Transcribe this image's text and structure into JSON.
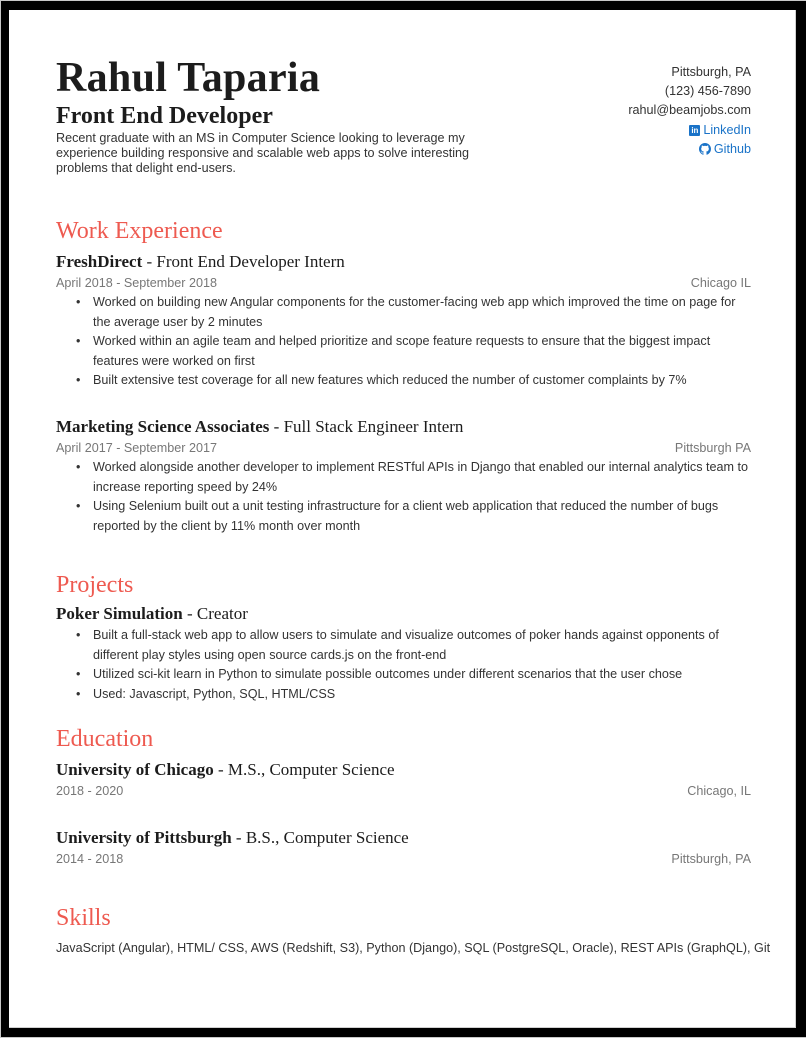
{
  "header": {
    "name": "Rahul Taparia",
    "title": "Front End Developer",
    "summary": "Recent graduate with an MS in Computer Science looking to leverage my experience building responsive and scalable web apps to solve interesting problems that delight end-users."
  },
  "contact": {
    "location": "Pittsburgh, PA",
    "phone": "(123) 456-7890",
    "email": "rahul@beamjobs.com",
    "linkedin_label": "LinkedIn",
    "linkedin_icon": "linkedin-icon",
    "github_label": "Github",
    "github_icon": "github-icon",
    "link_color": "#1a73c8"
  },
  "accent_color": "#ee5a50",
  "sections": {
    "work_title": "Work Experience",
    "projects_title": "Projects",
    "education_title": "Education",
    "skills_title": "Skills"
  },
  "work": [
    {
      "company": "FreshDirect",
      "role": " - Front End Developer Intern",
      "dates": "April 2018 - September 2018",
      "location": "Chicago IL",
      "bullets": [
        "Worked on building new Angular components for the customer-facing web app which improved the time on page for the average user by 2 minutes",
        "Worked within an agile team and helped prioritize and scope feature requests to ensure that the biggest impact features were worked on first",
        "Built extensive test coverage for all new features which reduced the number of customer complaints by 7%"
      ]
    },
    {
      "company": "Marketing Science Associates",
      "role": " - Full Stack Engineer Intern",
      "dates": "April 2017 - September 2017",
      "location": "Pittsburgh PA",
      "bullets": [
        "Worked alongside another developer to implement RESTful APIs in Django that enabled our internal analytics team to increase reporting speed by 24%",
        "Using Selenium built out a unit testing infrastructure for a client web application that reduced the number of bugs reported by the client by 11% month over month"
      ]
    }
  ],
  "projects": [
    {
      "name": "Poker Simulation",
      "role": " - Creator",
      "bullets": [
        "Built a full-stack web app to allow users to simulate and visualize outcomes of poker hands against opponents of different play styles using open source cards.js on the front-end",
        "Utilized sci-kit learn in Python to simulate possible outcomes under different scenarios that the user chose",
        "Used: Javascript, Python, SQL, HTML/CSS"
      ]
    }
  ],
  "education": [
    {
      "school": "University of Chicago",
      "degree": " - M.S., Computer Science",
      "dates": "2018 - 2020",
      "location": "Chicago, IL"
    },
    {
      "school": "University of Pittsburgh",
      "degree": " - B.S., Computer Science",
      "dates": "2014 - 2018",
      "location": "Pittsburgh, PA"
    }
  ],
  "skills": "JavaScript (Angular), HTML/ CSS, AWS (Redshift, S3), Python (Django), SQL (PostgreSQL, Oracle), REST APIs (GraphQL), Git"
}
